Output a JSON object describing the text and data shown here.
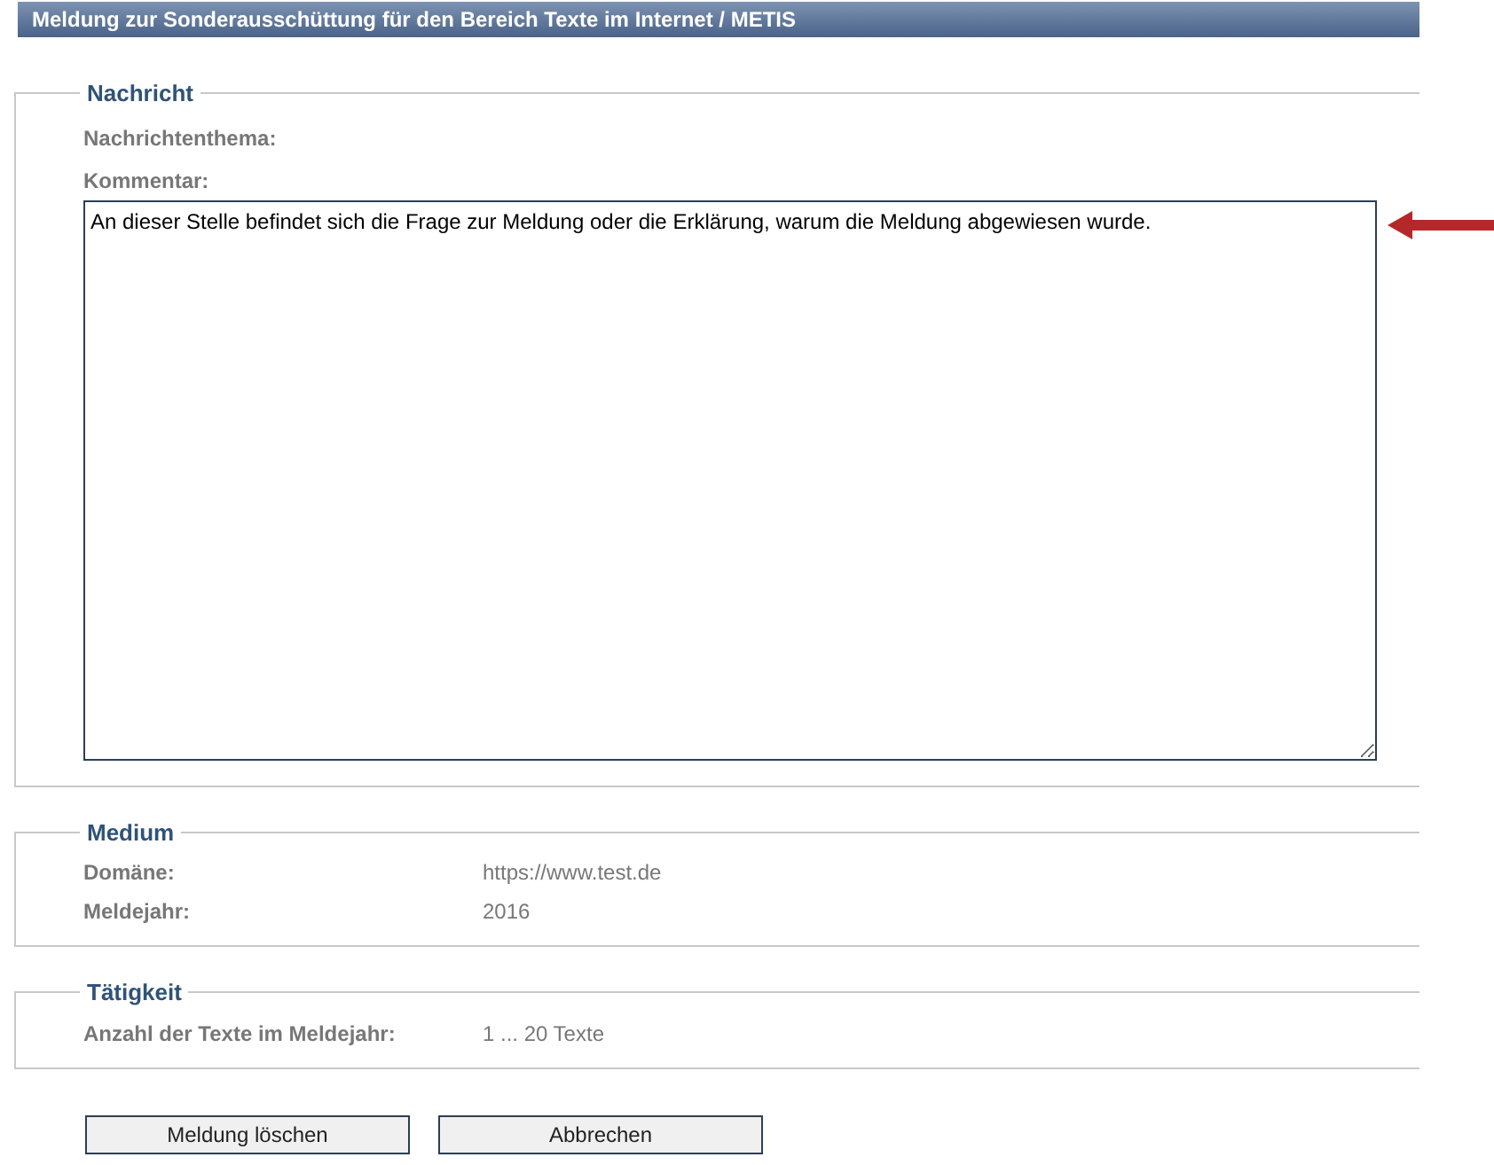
{
  "window": {
    "title": "Meldung zur Sonderausschüttung für den Bereich Texte im Internet / METIS"
  },
  "sections": [
    {
      "legend": "Nachricht",
      "kind": "message",
      "fields": [
        {
          "label": "Nachrichtenthema:"
        },
        {
          "label": "Kommentar:"
        }
      ],
      "comment": "An dieser Stelle befindet sich die Frage zur Meldung oder die Erklärung, warum die Meldung abgewiesen wurde."
    },
    {
      "legend": "Medium",
      "kind": "pairs",
      "fields": [
        {
          "label": "Domäne:",
          "value": "https://www.test.de"
        },
        {
          "label": "Meldejahr:",
          "value": "2016"
        }
      ]
    },
    {
      "legend": "Tätigkeit",
      "kind": "pairs",
      "fields": [
        {
          "label": "Anzahl der Texte im Meldejahr:",
          "value": "1 ... 20 Texte"
        }
      ]
    }
  ],
  "buttons": [
    "Meldung löschen",
    "Abbrechen"
  ]
}
